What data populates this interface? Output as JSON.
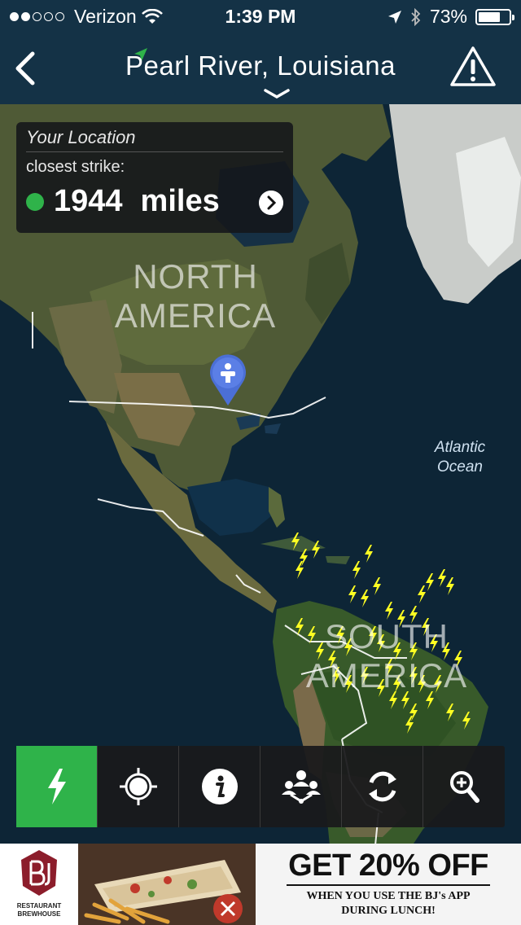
{
  "status_bar": {
    "carrier": "Verizon",
    "time": "1:39 PM",
    "battery": "73%",
    "battery_level": 0.73
  },
  "nav": {
    "title": "Pearl River, Louisiana"
  },
  "location_card": {
    "heading": "Your Location",
    "subheading": "closest strike:",
    "distance_value": "1944",
    "distance_unit": "miles",
    "status_color": "#2fb34a"
  },
  "map": {
    "labels": {
      "north_america_line1": "NORTH",
      "north_america_line2": "AMERICA",
      "south_america_line1": "SOUTH",
      "south_america_line2": "AMERICA",
      "ocean_line1": "Atlantic",
      "ocean_line2": "Ocean"
    },
    "strike_color": "#ffff22"
  },
  "toolbar": {
    "items": [
      {
        "icon": "lightning-icon",
        "active": true
      },
      {
        "icon": "crosshair-icon",
        "active": false
      },
      {
        "icon": "info-icon",
        "active": false
      },
      {
        "icon": "share-icon",
        "active": false
      },
      {
        "icon": "refresh-icon",
        "active": false
      },
      {
        "icon": "zoom-icon",
        "active": false
      }
    ],
    "accent": "#2fb34a"
  },
  "ad": {
    "headline": "GET 20% OFF",
    "line1": "WHEN YOU USE THE BJ's APP",
    "line2": "DURING LUNCH!",
    "brand_line1": "RESTAURANT",
    "brand_line2": "BREWHOUSE"
  }
}
